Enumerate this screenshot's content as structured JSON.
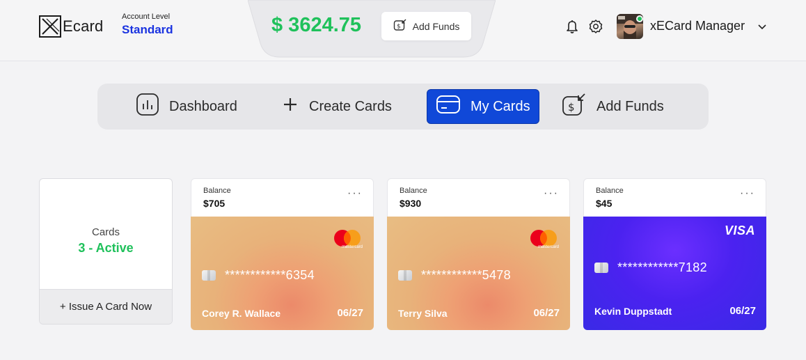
{
  "header": {
    "logo_text": "Ecard",
    "account_label": "Account Level",
    "account_value": "Standard",
    "balance": "$ 3624.75",
    "add_funds_label": "Add Funds",
    "user_name": "xECard Manager"
  },
  "nav": {
    "items": [
      {
        "label": "Dashboard",
        "icon": "chart-icon"
      },
      {
        "label": "Create Cards",
        "icon": "plus-icon"
      },
      {
        "label": "My Cards",
        "icon": "card-icon",
        "active": true
      },
      {
        "label": "Add Funds",
        "icon": "add-funds-icon"
      }
    ]
  },
  "summary": {
    "label": "Cards",
    "value": "3 - Active",
    "issue_label": "+ Issue A Card Now"
  },
  "cards": [
    {
      "balance_label": "Balance",
      "balance": "$705",
      "number": "************6354",
      "holder": "Corey R. Wallace",
      "expiry": "06/27",
      "brand": "mastercard",
      "brand_label": "mastercard"
    },
    {
      "balance_label": "Balance",
      "balance": "$930",
      "number": "************5478",
      "holder": "Terry Silva",
      "expiry": "06/27",
      "brand": "mastercard",
      "brand_label": "mastercard"
    },
    {
      "balance_label": "Balance",
      "balance": "$45",
      "number": "************7182",
      "holder": "Kevin Duppstadt",
      "expiry": "06/27",
      "brand": "visa",
      "brand_label": "VISA"
    }
  ],
  "colors": {
    "accent_blue": "#1048d8",
    "balance_green": "#1fc15b",
    "account_blue": "#1a33e0",
    "card_gold": "#e8b27a",
    "card_purple": "#4b22f0"
  }
}
